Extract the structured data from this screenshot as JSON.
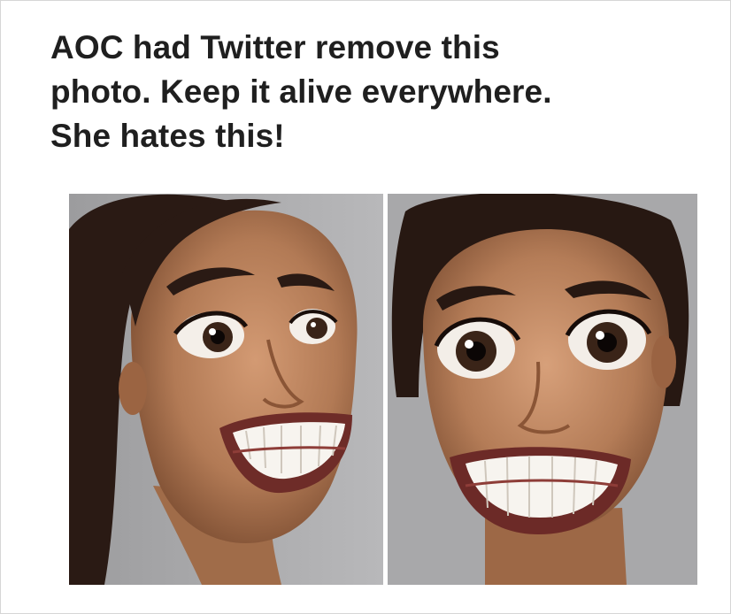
{
  "caption": {
    "lines": [
      "AOC had Twitter remove this",
      "photo.  Keep it alive everywhere.",
      "She hates this!"
    ]
  },
  "images": {
    "left": "caricature-face-side-view",
    "right": "caricature-face-front-view"
  },
  "colors": {
    "background": "#ffffff",
    "text": "#1f1f1f",
    "photo_backdrop": "#a9a9ab",
    "skin": "#b27a55",
    "hair": "#2a1a14"
  }
}
